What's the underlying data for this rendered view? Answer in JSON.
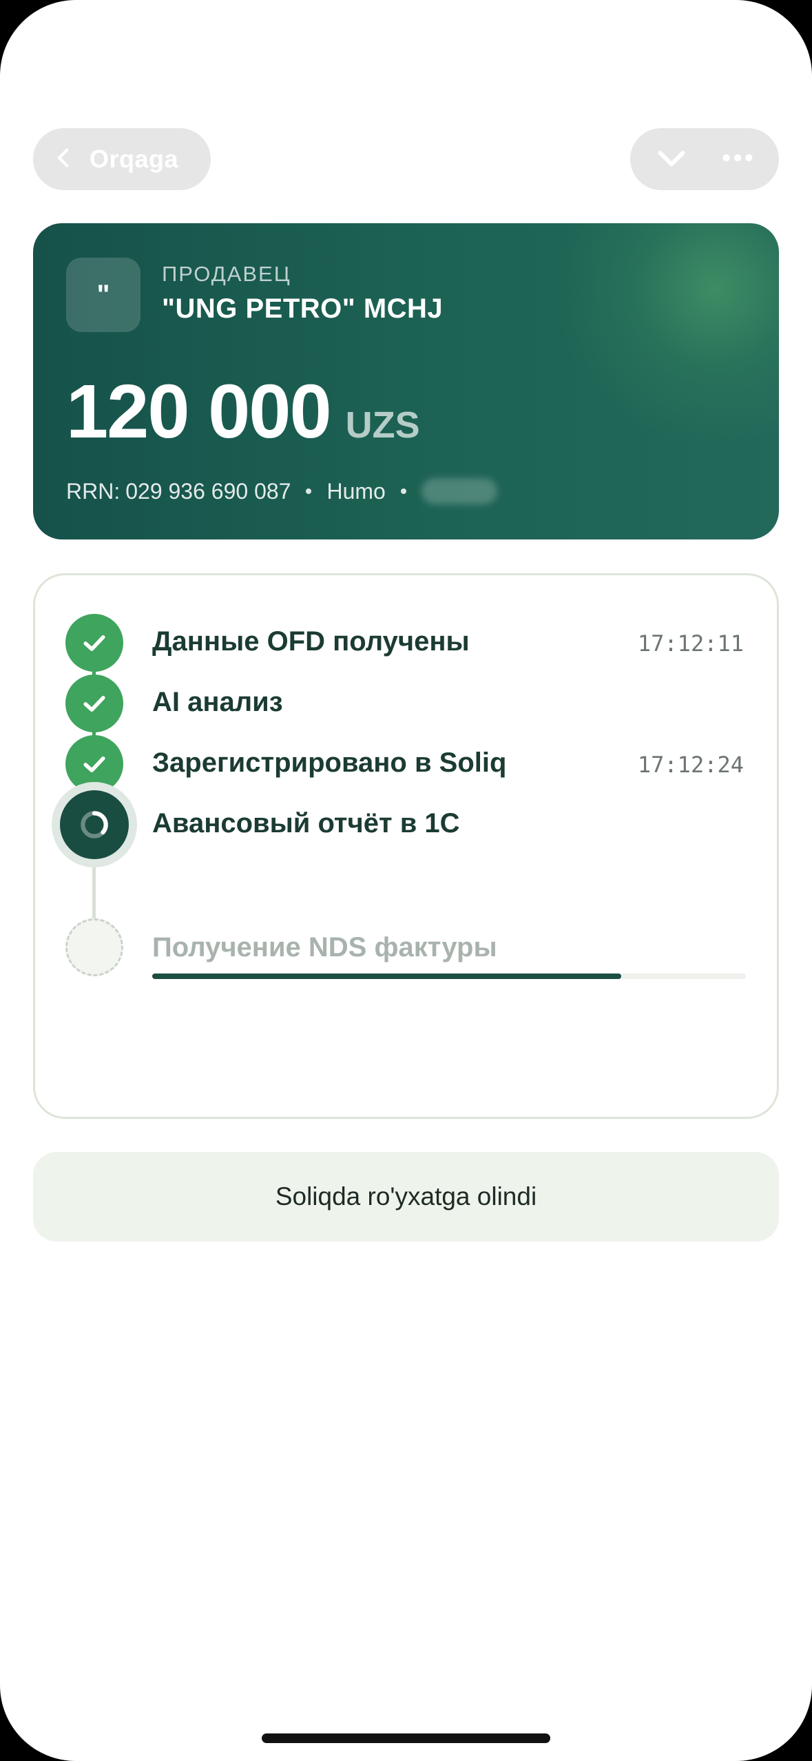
{
  "nav": {
    "back_label": "Orqaga",
    "back_icon": "chevron-left-icon",
    "collapse_icon": "chevron-down-icon",
    "more_icon": "more-horizontal-icon"
  },
  "merchant": {
    "avatar_text": "\"",
    "caption": "ПРОДАВЕЦ",
    "name": "\"UNG PETRO\" MCHJ",
    "amount": "120 000",
    "currency": "UZS",
    "rrn_label": "RRN:",
    "rrn_value": "029 936 690 087",
    "card_type": "Humo",
    "card_number_masked": true
  },
  "timeline": {
    "steps": [
      {
        "title": "Данные OFD получены",
        "time": "17:12:11",
        "status": "done"
      },
      {
        "title": "AI анализ",
        "time": "",
        "status": "done"
      },
      {
        "title": "Зарегистрировано в Soliq",
        "time": "17:12:24",
        "status": "done"
      },
      {
        "title": "Авансовый отчёт в 1С",
        "time": "",
        "status": "in-progress",
        "progress": 0.79
      },
      {
        "title": "Получение NDS фактуры",
        "time": "",
        "status": "pending"
      }
    ]
  },
  "status": {
    "message": "Soliqda ro'yxatga olindi"
  },
  "colors": {
    "accent_green": "#3fa45d",
    "dark_green": "#1a4d42",
    "card_gradient_start": "#16524a",
    "card_gradient_end": "#23695a",
    "muted_text": "#a9b3ad",
    "banner_bg": "#eef3ec"
  }
}
